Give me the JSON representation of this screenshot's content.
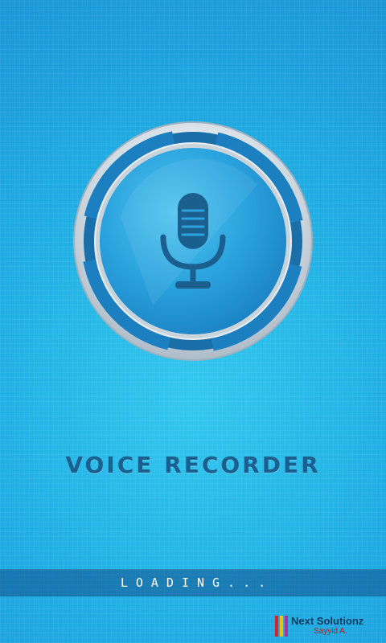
{
  "app": {
    "title": "VOICE RECORDER",
    "loading_text": "LOADING..."
  },
  "logo": {
    "icon": "microphone-icon",
    "ring_color": "#c9d3dc",
    "segment_color": "#1b7fc0",
    "center_color": "#2aa3de",
    "mic_color": "#1a5f8e"
  },
  "brand": {
    "name": "Next Solutionz",
    "author": "Sayyid A.",
    "stripe_colors": [
      "#e02020",
      "#f2c200",
      "#b0309c"
    ]
  },
  "colors": {
    "background_light": "#33c9ee",
    "background_dark": "#1a90d2",
    "title": "#1a5f8e",
    "loading_bar": "#14508c"
  }
}
